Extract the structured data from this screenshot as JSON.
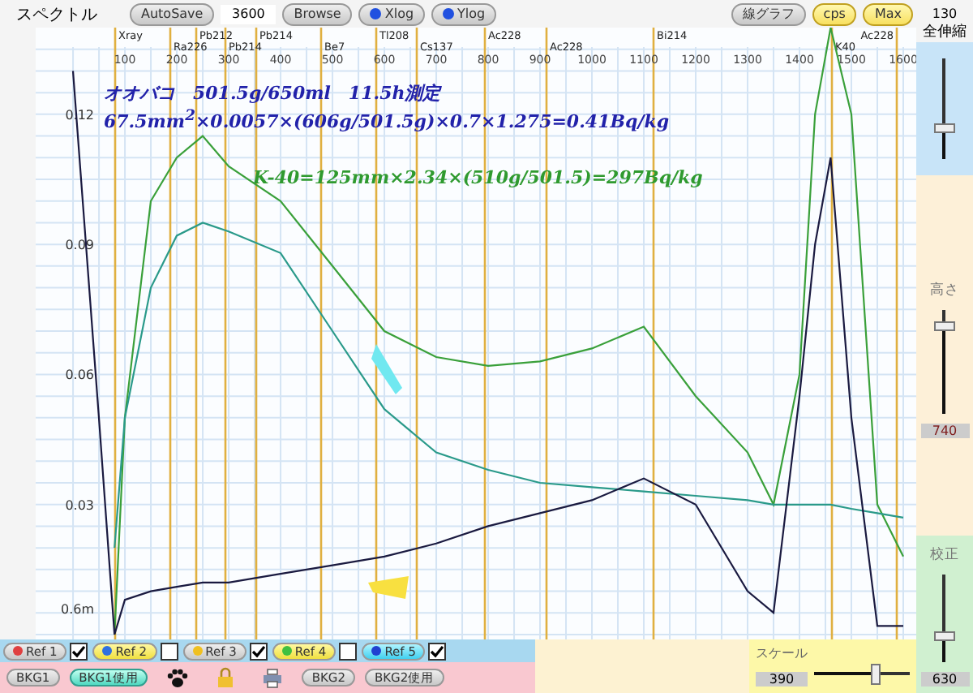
{
  "panel_title": "スペクトル",
  "toolbar": [
    {
      "kind": "button",
      "label": "AutoSave",
      "on": false
    },
    {
      "kind": "field",
      "value": "3600"
    },
    {
      "kind": "button",
      "label": "Browse",
      "on": false
    },
    {
      "kind": "toggle",
      "label": "Xlog",
      "on": false
    },
    {
      "kind": "toggle",
      "label": "Ylog",
      "on": false
    },
    {
      "kind": "spacer"
    },
    {
      "kind": "button",
      "label": "線グラフ",
      "on": false
    },
    {
      "kind": "button",
      "label": "cps",
      "on": true
    },
    {
      "kind": "button",
      "label": "Max",
      "on": true
    }
  ],
  "chart_data": {
    "type": "line",
    "x": [
      0,
      50,
      80,
      100,
      150,
      200,
      250,
      300,
      400,
      500,
      600,
      700,
      800,
      900,
      1000,
      1100,
      1200,
      1300,
      1350,
      1400,
      1430,
      1460,
      1500,
      1550,
      1600
    ],
    "xlim": [
      -72,
      1625
    ],
    "ylim": [
      0,
      0.14
    ],
    "grid": true,
    "xticks": [
      100,
      200,
      300,
      400,
      500,
      600,
      700,
      800,
      900,
      1000,
      1100,
      1200,
      1300,
      1400,
      1500,
      1600
    ],
    "yticks": [
      {
        "value": 0.03,
        "label": "0.03"
      },
      {
        "value": 0.06,
        "label": "0.06"
      },
      {
        "value": 0.09,
        "label": "0.09"
      },
      {
        "value": 0.12,
        "label": "0.12"
      }
    ],
    "series": [
      {
        "color": "#3aa03a",
        "values": [
          null,
          null,
          0.0,
          0.05,
          0.1,
          0.11,
          0.115,
          0.108,
          0.1,
          0.085,
          0.07,
          0.064,
          0.062,
          0.063,
          0.066,
          0.071,
          0.055,
          0.042,
          0.03,
          0.06,
          0.12,
          0.14,
          0.12,
          0.03,
          0.018
        ]
      },
      {
        "color": "#2a9a8a",
        "values": [
          null,
          null,
          0.02,
          0.05,
          0.08,
          0.092,
          0.095,
          0.093,
          0.088,
          0.07,
          0.052,
          0.042,
          0.038,
          0.035,
          0.034,
          0.033,
          0.032,
          0.031,
          0.03,
          0.03,
          0.03,
          0.03,
          0.029,
          0.028,
          0.027
        ]
      },
      {
        "color": "#1a1a40",
        "values": [
          0.13,
          0.05,
          0.0,
          0.008,
          0.01,
          0.011,
          0.012,
          0.012,
          0.014,
          0.016,
          0.018,
          0.021,
          0.025,
          0.028,
          0.031,
          0.036,
          0.03,
          0.01,
          0.005,
          0.055,
          0.09,
          0.11,
          0.05,
          0.002,
          0.002
        ]
      }
    ]
  },
  "annotations": [
    {
      "text": "オオバコ　501.5g/650ml　11.5h測定",
      "color": "#2222aa"
    },
    {
      "text": "67.5mm$^{2}$×0.0057×(606g/501.5g)×0.7×1.275=0.41Bq/kg",
      "color": "#2222aa"
    },
    {
      "text": "K-40=125mm×2.34×(510g/501.5)=297Bq/kg",
      "color": "#2f9a2f"
    }
  ],
  "axis_bottom_label": "0.6m",
  "peak_labels": [
    "Xray",
    "Ra226",
    "Pb212",
    "Pb214",
    "Pb214",
    "Be7",
    "Tl208",
    "Cs137",
    "Ac228",
    "Ac228",
    "Bi214",
    "K40",
    "Ac228"
  ],
  "side_panel": {
    "zoom": {
      "value": "130",
      "label": "全伸縮",
      "level": 0.3
    },
    "height": {
      "label": "高さ",
      "level": 0.85,
      "value": "740"
    },
    "calibration": {
      "label": "校正",
      "level": 0.3,
      "value": "630"
    }
  },
  "refs": [
    {
      "label": "Ref 1",
      "color": "#e04040",
      "on": false,
      "checked": true
    },
    {
      "label": "Ref 2",
      "color": "#3070e0",
      "on": true,
      "checked": false
    },
    {
      "label": "Ref 3",
      "color": "#f0c020",
      "on": false,
      "checked": true
    },
    {
      "label": "Ref 4",
      "color": "#40c040",
      "on": true,
      "checked": false
    },
    {
      "label": "Ref 5",
      "color": "#2040d0",
      "on": true,
      "checked": true
    }
  ],
  "bkg_buttons": [
    {
      "label": "BKG1",
      "on": false
    },
    {
      "label": "BKG1使用",
      "on": true
    }
  ],
  "bkg2_buttons": [
    {
      "label": "BKG2",
      "on": false
    },
    {
      "label": "BKG2使用",
      "on": false
    }
  ],
  "scale": {
    "label": "スケール",
    "value": "390",
    "level": 0.65
  }
}
